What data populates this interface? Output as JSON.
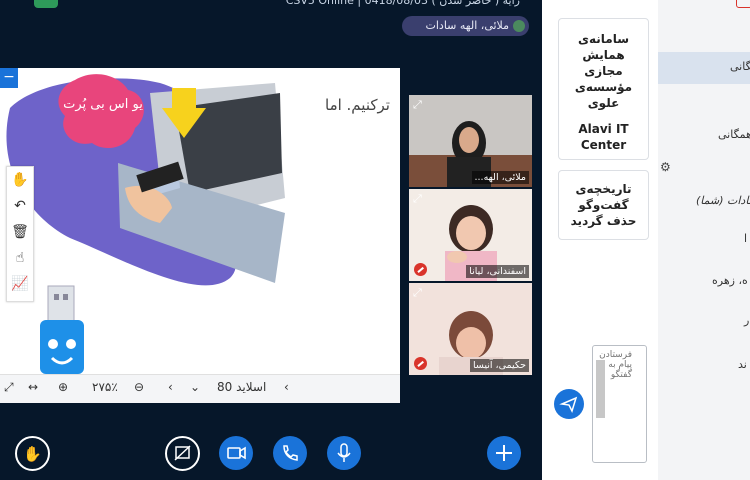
{
  "header": {
    "title": "رایه ( حاضر شدن ) CSV5 Online | 0418/08/03"
  },
  "speaker": {
    "name": "ملائی، الهه سادات"
  },
  "presentation": {
    "slide_text": "ترکنیم. اما",
    "sticker_text": "یو اس بی پُرت",
    "zoom": "۲۷۵٪",
    "slide_label": "اسلاید 80"
  },
  "videos": [
    {
      "name": "ملائی، الهه..."
    },
    {
      "name": "اسفندانی، لیانا"
    },
    {
      "name": "حکیمی، آنیسا"
    }
  ],
  "chat": {
    "welcome_title": "سامانه‌ی همایش مجازی مؤسسه‌ی علوی",
    "welcome_sub": "Alavi IT Center",
    "cleared": "تاریخچه‌ی گفت‌وگو حذف گردید",
    "input_placeholder": "فرستادن پیام به گفتگو"
  },
  "users_panel": {
    "items": [
      "همگانی",
      "گفتگوی همگانی",
      "سادات (شما)",
      "ا",
      "ه، زهره",
      "ر",
      "ند"
    ]
  },
  "colors": {
    "accent": "#1a73d9",
    "background": "#06172a",
    "mute": "#d9342b"
  }
}
